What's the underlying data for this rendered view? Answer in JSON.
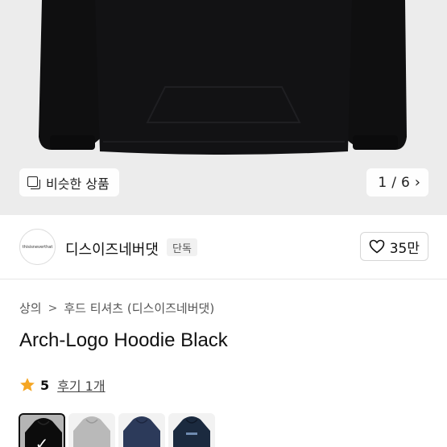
{
  "hero": {
    "similar_label": "비슷한 상품",
    "pager": {
      "current": "1",
      "separator": "/",
      "total": "6"
    }
  },
  "brand": {
    "logo_text": "thisisneverthat",
    "name": "디스이즈네버댓",
    "badge": "단독",
    "likes": "35만"
  },
  "breadcrumb": {
    "items": [
      "상의",
      "후드 티셔츠 (디스이즈네버댓)"
    ],
    "separator": ">"
  },
  "product": {
    "title": "Arch-Logo Hoodie Black",
    "rating": "5",
    "reviews": "후기 1개"
  },
  "thumbnails": [
    {
      "color": "#111111",
      "selected": true
    },
    {
      "color": "#b9b9b9",
      "selected": false
    },
    {
      "color": "#2c3a5a",
      "selected": false
    },
    {
      "color": "#1b2a3f",
      "selected": false
    }
  ],
  "icons": {
    "similar": "copy-icon",
    "pager_next": "chevron-right-icon",
    "like": "heart-icon",
    "star": "star-icon",
    "check": "check-icon"
  },
  "colors": {
    "star": "#f5a623",
    "hero_bg": "#ececec",
    "hoodie": "#0f0f10"
  }
}
